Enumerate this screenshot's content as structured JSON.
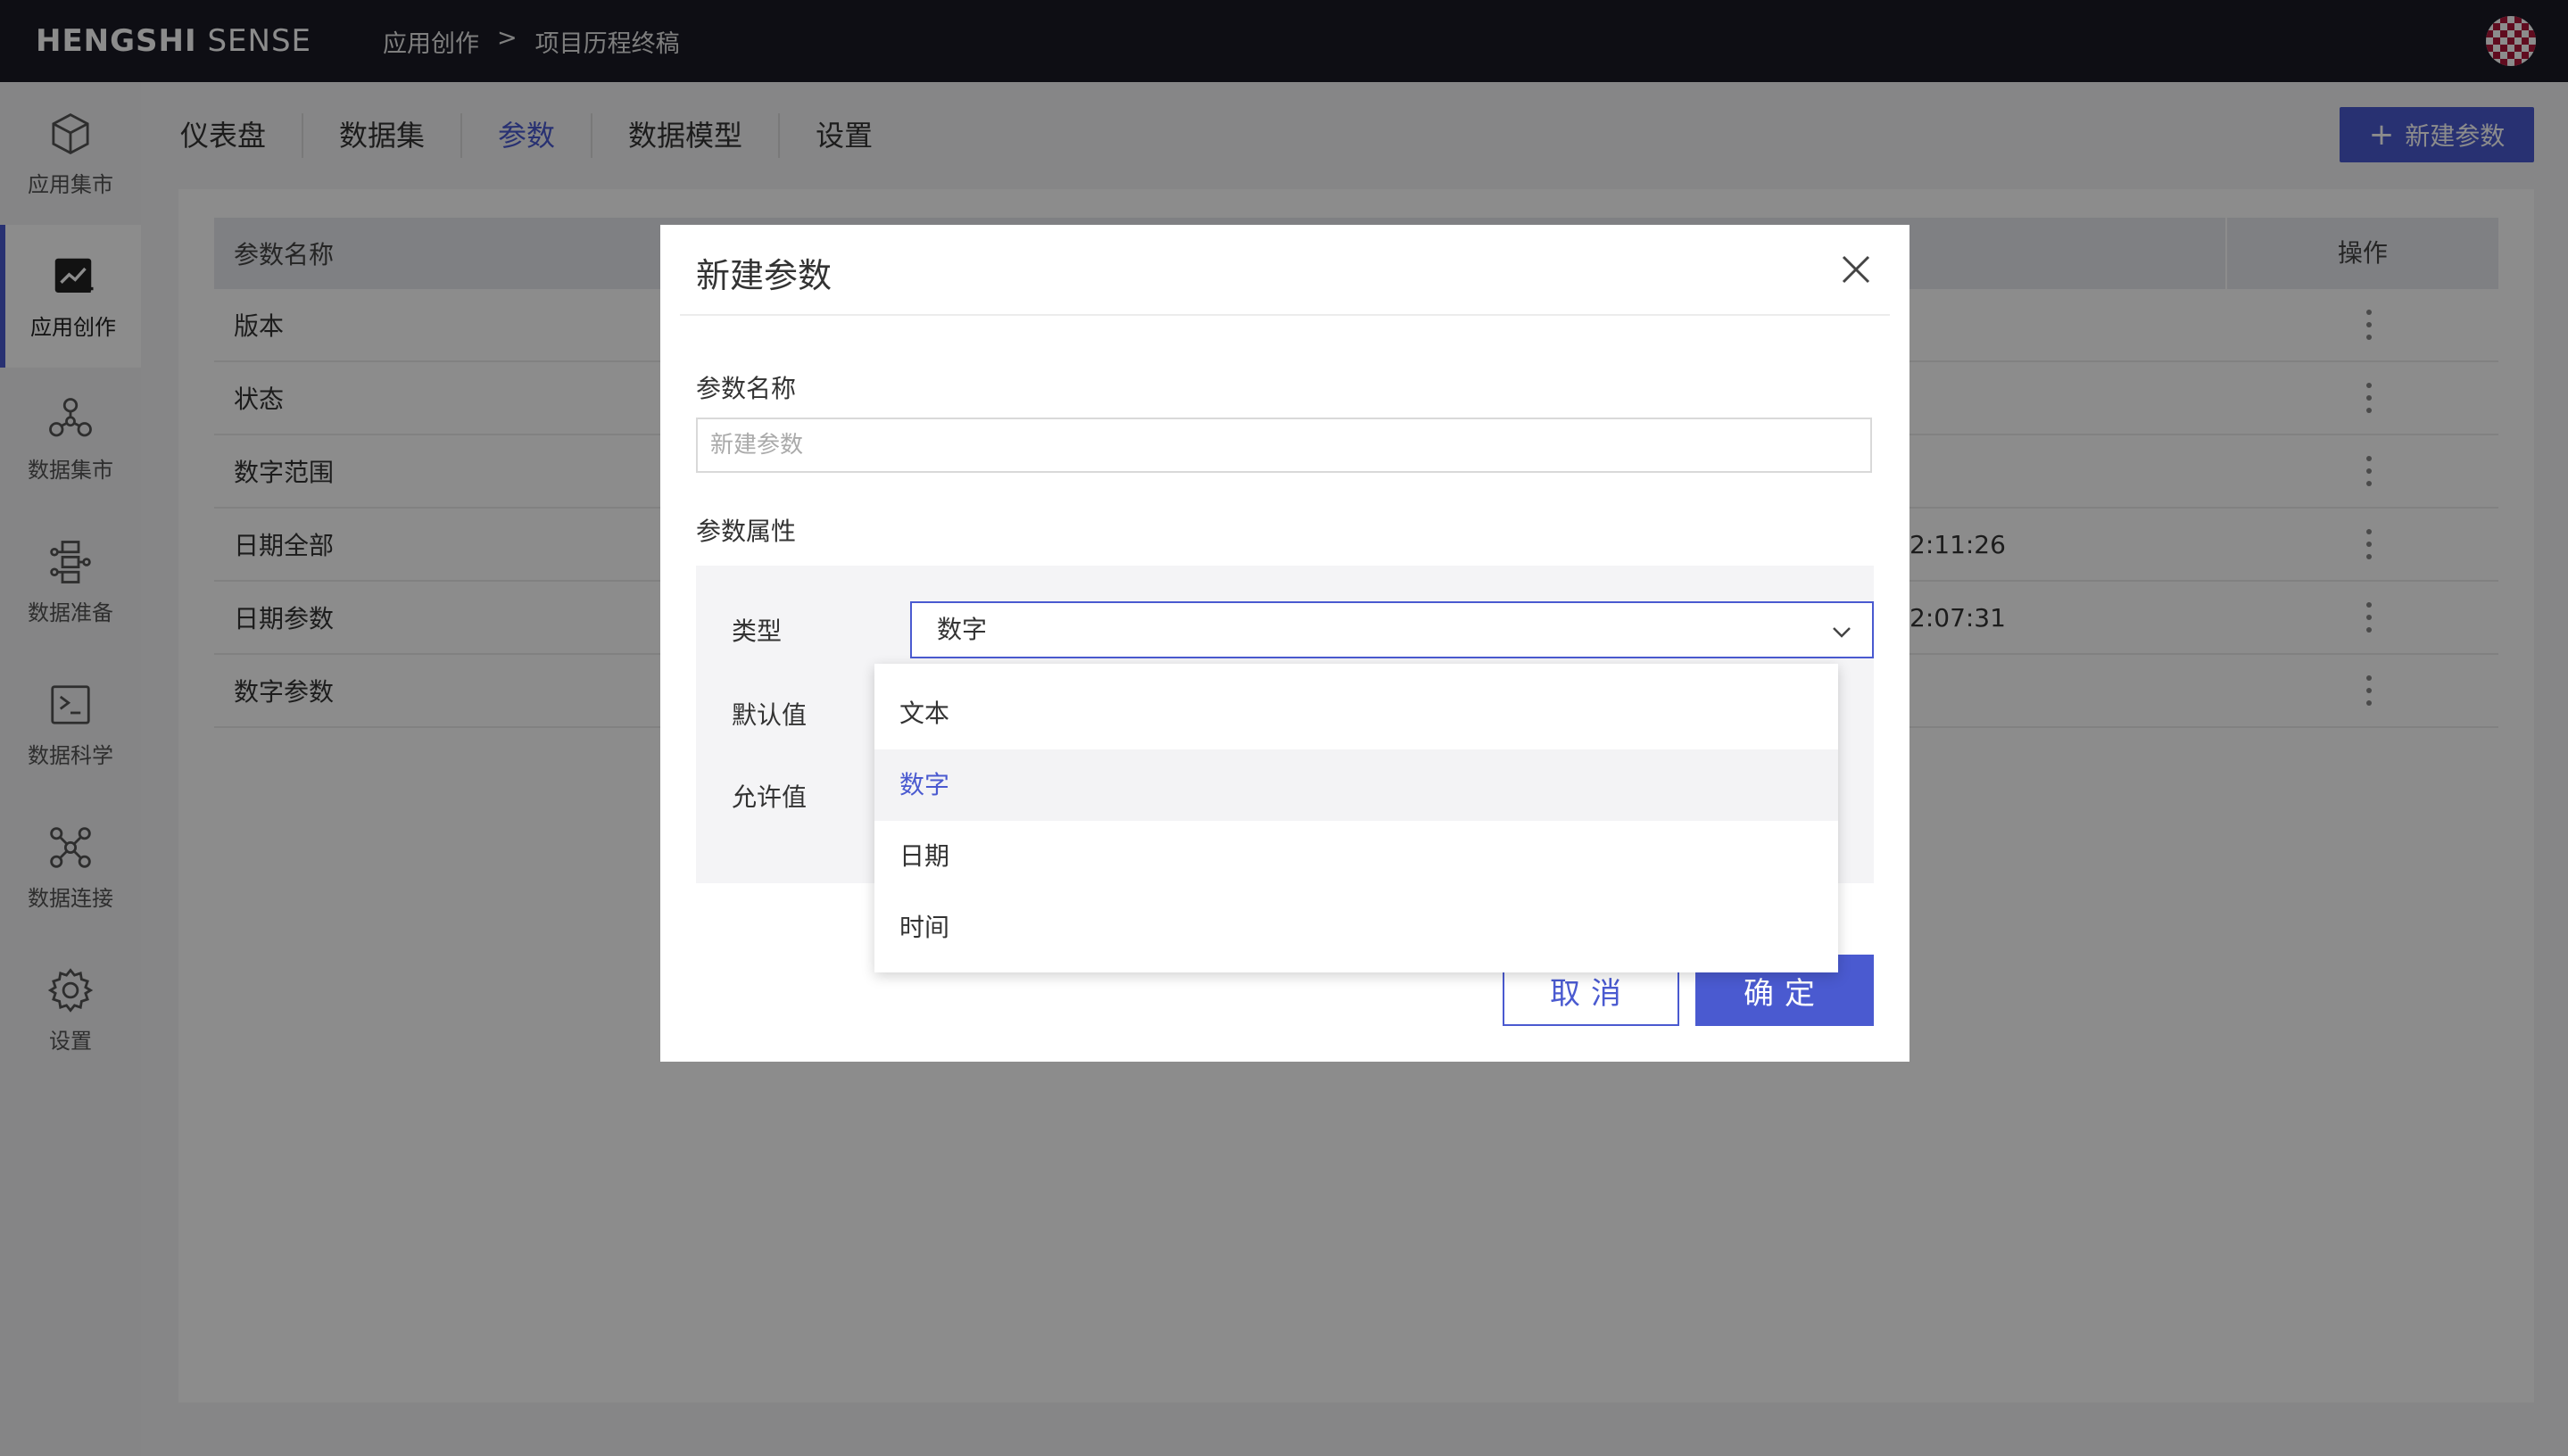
{
  "topbar": {
    "brand_bold": "HENGSHI",
    "brand_light": "SENSE",
    "breadcrumb": [
      "应用创作",
      ">",
      "项目历程终稿"
    ]
  },
  "sidebar": {
    "items": [
      {
        "label": "应用集市",
        "icon": "cube-icon"
      },
      {
        "label": "应用创作",
        "icon": "chart-edit-icon"
      },
      {
        "label": "数据集市",
        "icon": "network-icon"
      },
      {
        "label": "数据准备",
        "icon": "flow-icon"
      },
      {
        "label": "数据科学",
        "icon": "terminal-icon"
      },
      {
        "label": "数据连接",
        "icon": "connect-icon"
      },
      {
        "label": "设置",
        "icon": "gear-icon"
      }
    ],
    "active_index": 1
  },
  "tabs": [
    {
      "label": "仪表盘"
    },
    {
      "label": "数据集"
    },
    {
      "label": "参数"
    },
    {
      "label": "数据模型"
    },
    {
      "label": "设置"
    }
  ],
  "active_tab": 2,
  "new_param_button": "新建参数",
  "table": {
    "headers": {
      "name": "参数名称",
      "ops": "操作"
    },
    "rows": [
      {
        "name": "版本",
        "time": ""
      },
      {
        "name": "状态",
        "time": ""
      },
      {
        "name": "数字范围",
        "time": ""
      },
      {
        "name": "日期全部",
        "time": "2:11:26"
      },
      {
        "name": "日期参数",
        "time": "2:07:31"
      },
      {
        "name": "数字参数",
        "time": ""
      }
    ]
  },
  "modal": {
    "title": "新建参数",
    "name_label": "参数名称",
    "name_placeholder": "新建参数",
    "props_label": "参数属性",
    "type_label": "类型",
    "type_value": "数字",
    "default_label": "默认值",
    "allowed_label": "允许值",
    "options": [
      "文本",
      "数字",
      "日期",
      "时间"
    ],
    "selected_option": 1,
    "cancel": "取消",
    "ok": "确定"
  },
  "colors": {
    "accent": "#4a5ad0",
    "topbar": "#1a1b26"
  }
}
